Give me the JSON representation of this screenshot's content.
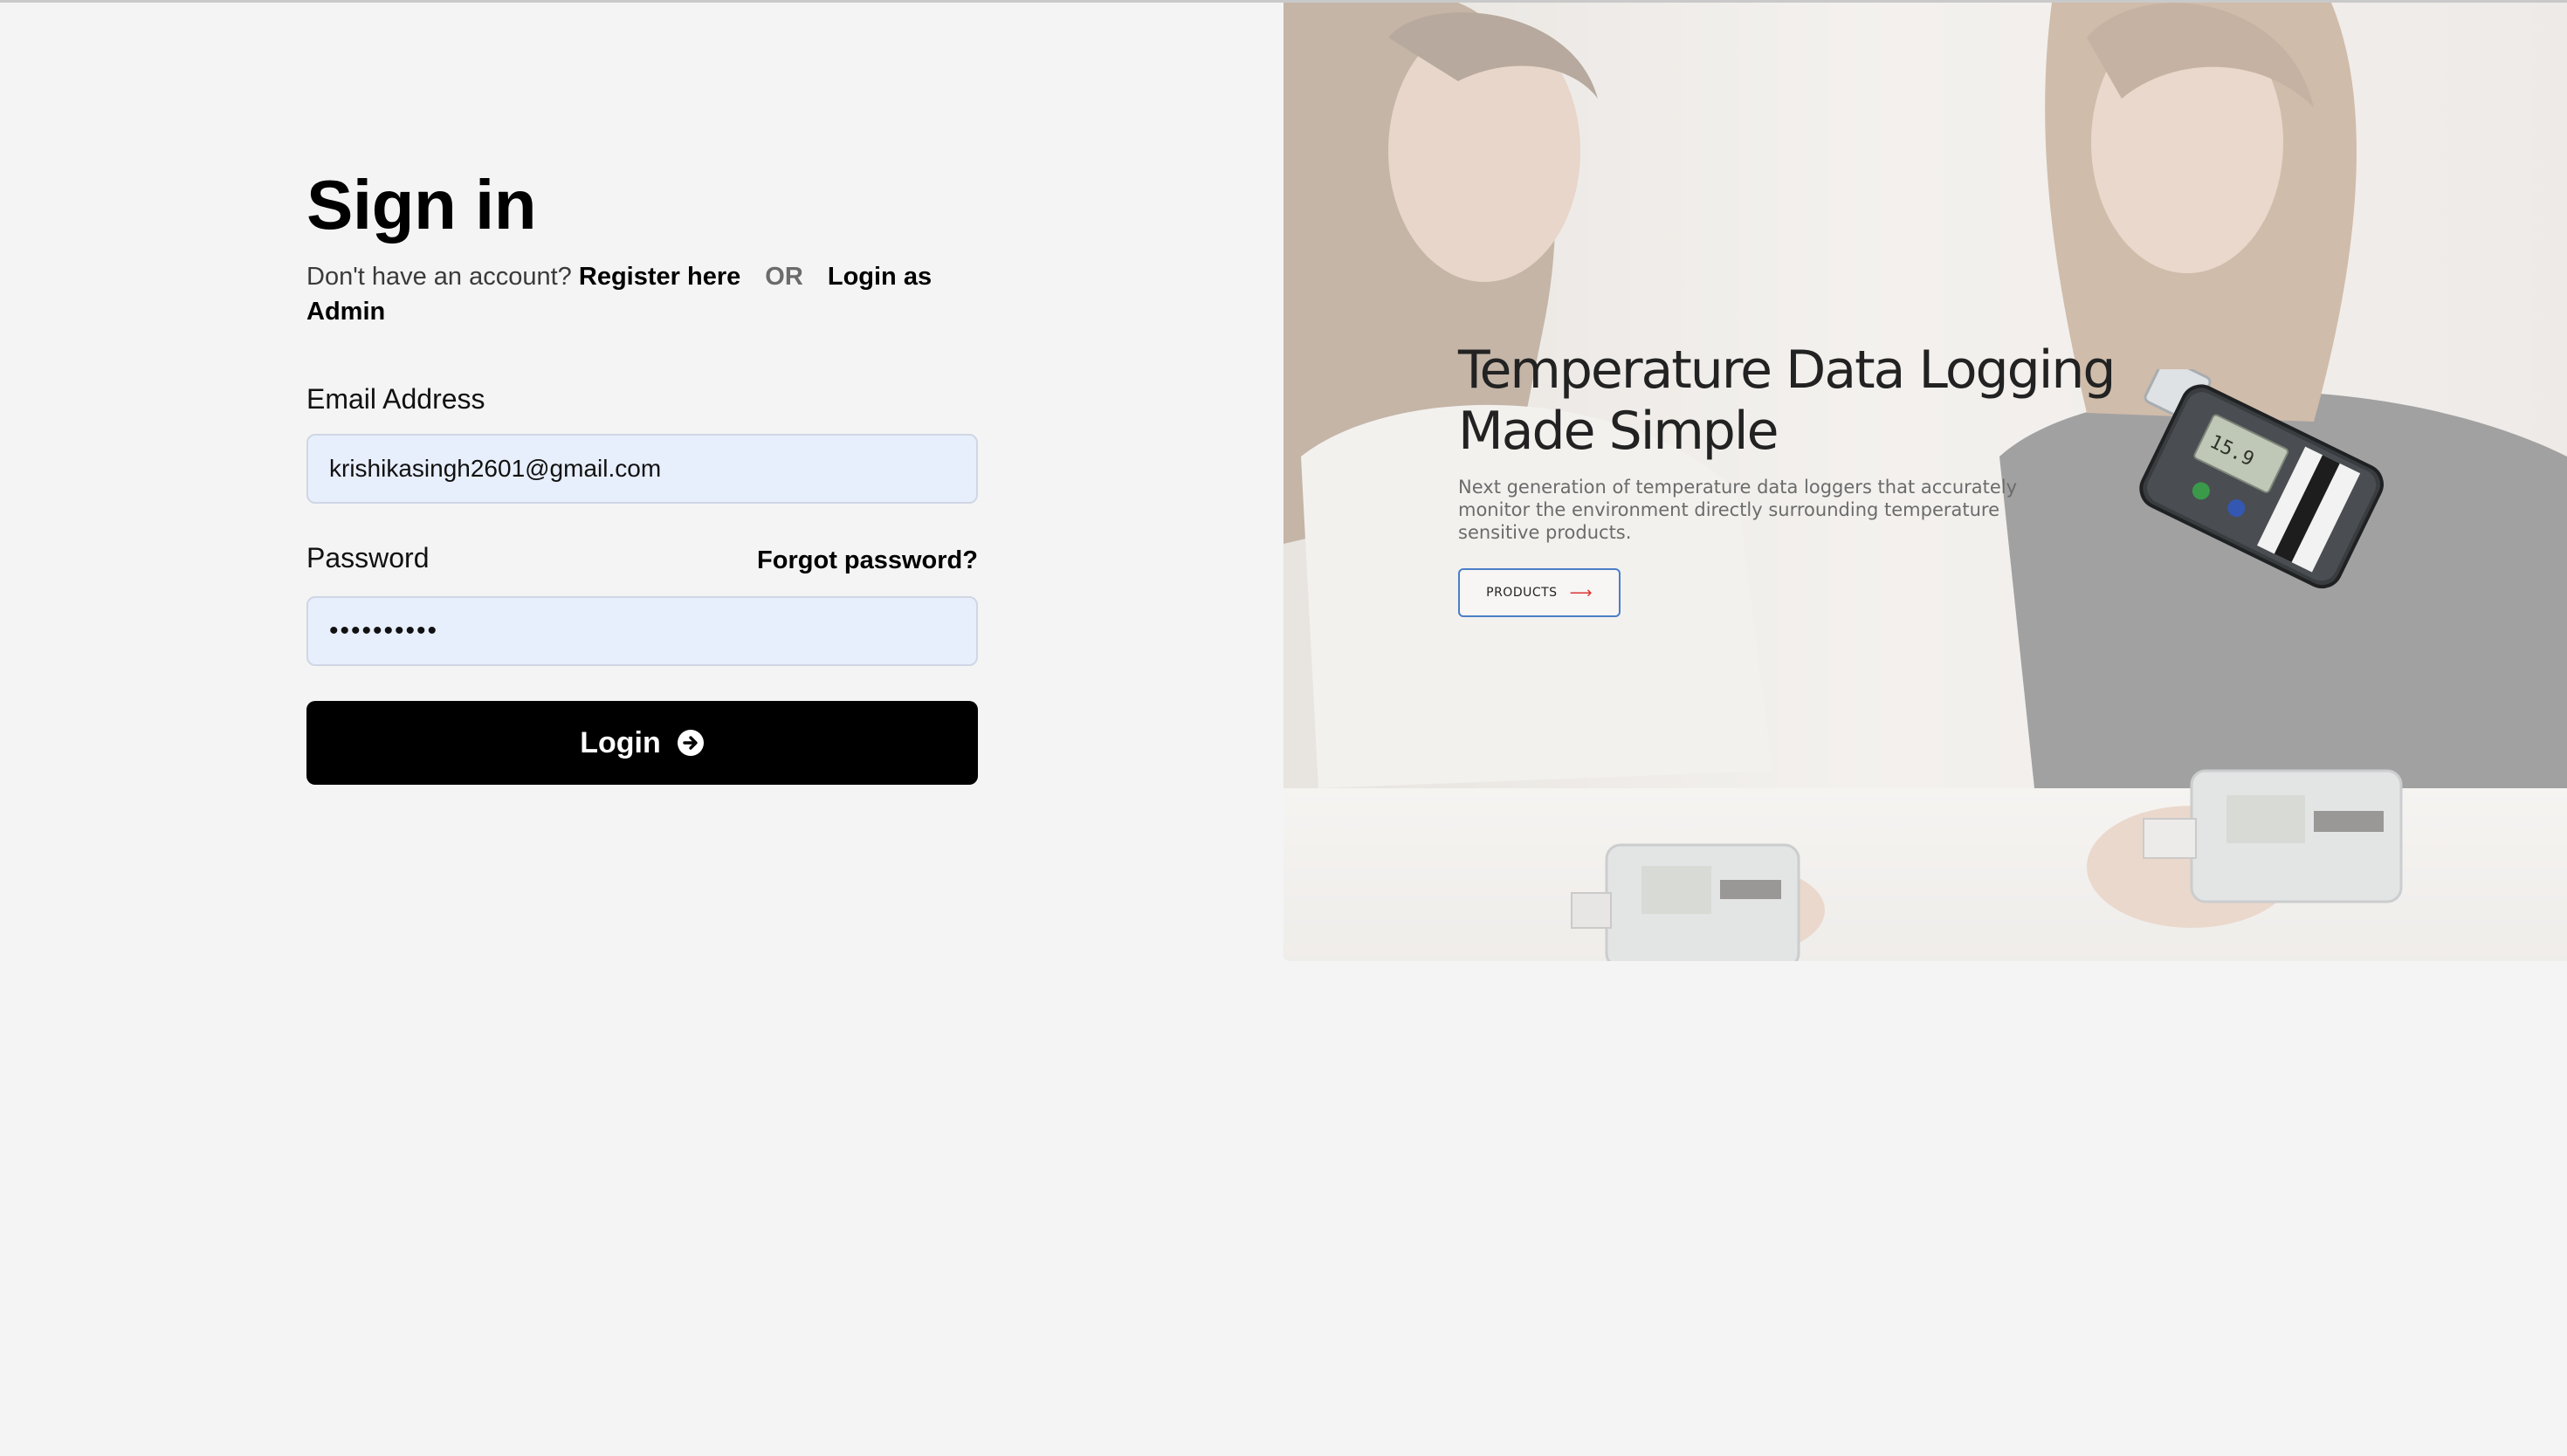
{
  "signin": {
    "title": "Sign in",
    "no_account_text": "Don't have an account?",
    "register_link": "Register here",
    "or_text": "OR",
    "admin_link": "Login as Admin",
    "email_label": "Email Address",
    "email_value": "krishikasingh2601@gmail.com",
    "password_label": "Password",
    "forgot_link": "Forgot password?",
    "password_value": "••••••••••",
    "login_button": "Login"
  },
  "hero": {
    "headline": "Temperature Data Logging Made Simple",
    "subtext": "Next generation of temperature data loggers that accurately monitor the environment directly surrounding temperature sensitive products.",
    "products_button": "PRODUCTS",
    "products_arrow": "⟶"
  },
  "colors": {
    "background": "#f4f4f4",
    "input_fill": "#e8effc",
    "button": "#000000",
    "hero_button_border": "#4a7fc6",
    "hero_arrow": "#dd3333"
  },
  "icons": {
    "login_button_icon": "arrow-circle-right-icon"
  }
}
